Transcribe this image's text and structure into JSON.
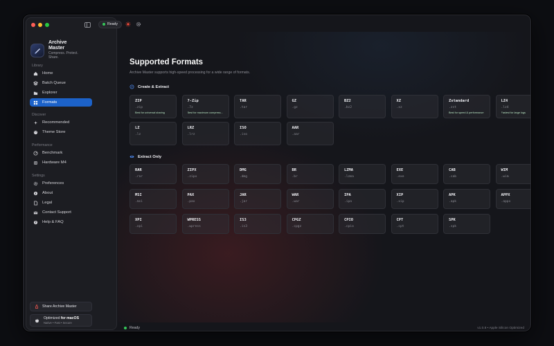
{
  "sidebar": {
    "brand": {
      "name": "Archive Master",
      "tagline": "Compress. Protect. Share."
    },
    "sections": {
      "library": "Library",
      "discover": "Discover",
      "performance": "Performance",
      "settings": "Settings"
    },
    "items": {
      "home": "Home",
      "batch_queue": "Batch Queue",
      "explorer": "Explorer",
      "formats": "Formats",
      "recommended": "Recommended",
      "theme_store": "Theme Store",
      "benchmark": "Benchmark",
      "hardware": "Hardware M4",
      "preferences": "Preferences",
      "about": "About",
      "legal": "Legal",
      "contact_support": "Contact Support",
      "help_faq": "Help & FAQ"
    },
    "share_label": "Share Archive Master",
    "optimized": {
      "prefix": "Optimized",
      "suffix": "for macOS",
      "sub": "Native • Fast • Secure"
    }
  },
  "toolbar": {
    "status": "Ready"
  },
  "main": {
    "title": "Supported Formats",
    "subtitle": "Archive Master supports high-speed processing for a wide range of formats.",
    "create_extract": {
      "heading": "Create & Extract",
      "formats": [
        {
          "name": "ZIP",
          "ext": ".zip",
          "note": "Best for universal sharing"
        },
        {
          "name": "7-Zip",
          "ext": ".7z",
          "note": "Best for maximum compress..."
        },
        {
          "name": "TAR",
          "ext": ".tar",
          "note": ""
        },
        {
          "name": "GZ",
          "ext": ".gz",
          "note": ""
        },
        {
          "name": "BZ2",
          "ext": ".bz2",
          "note": ""
        },
        {
          "name": "XZ",
          "ext": ".xz",
          "note": ""
        },
        {
          "name": "Zstandard",
          "ext": ".zst",
          "note": "Best for speed & performance"
        },
        {
          "name": "LZ4",
          "ext": ".lz4",
          "note": "Fastest for large logs"
        },
        {
          "name": "LZ",
          "ext": ".lz",
          "note": ""
        },
        {
          "name": "LRZ",
          "ext": ".lrz",
          "note": ""
        },
        {
          "name": "ISO",
          "ext": ".iso",
          "note": ""
        },
        {
          "name": "AAR",
          "ext": ".aar",
          "note": ""
        }
      ]
    },
    "extract_only": {
      "heading": "Extract Only",
      "formats": [
        {
          "name": "RAR",
          "ext": ".rar"
        },
        {
          "name": "ZIPX",
          "ext": ".zipx"
        },
        {
          "name": "DMG",
          "ext": ".dmg"
        },
        {
          "name": "BR",
          "ext": ".br"
        },
        {
          "name": "LZMA",
          "ext": ".lzma"
        },
        {
          "name": "EXE",
          "ext": ".exe"
        },
        {
          "name": "CAB",
          "ext": ".cab"
        },
        {
          "name": "WIM",
          "ext": ".wim"
        },
        {
          "name": "MSI",
          "ext": ".msi"
        },
        {
          "name": "PAX",
          "ext": ".pax"
        },
        {
          "name": "JAR",
          "ext": ".jar"
        },
        {
          "name": "WAR",
          "ext": ".war"
        },
        {
          "name": "IPA",
          "ext": ".ipa"
        },
        {
          "name": "XIP",
          "ext": ".xip"
        },
        {
          "name": "APK",
          "ext": ".apk"
        },
        {
          "name": "APPX",
          "ext": ".appx"
        },
        {
          "name": "XPI",
          "ext": ".xpi"
        },
        {
          "name": "WPRESS",
          "ext": ".wpress"
        },
        {
          "name": "IS3",
          "ext": ".is3"
        },
        {
          "name": "CPGZ",
          "ext": ".cpgz"
        },
        {
          "name": "CPIO",
          "ext": ".cpio"
        },
        {
          "name": "CPT",
          "ext": ".cpt"
        },
        {
          "name": "SPK",
          "ext": ".spk"
        }
      ]
    }
  },
  "statusbar": {
    "status": "Ready",
    "version": "v1.0.8 • Apple Silicon Optimized"
  },
  "colors": {
    "accent": "#1c62c9",
    "ready": "#35c759",
    "note": "#b8e4c2"
  }
}
